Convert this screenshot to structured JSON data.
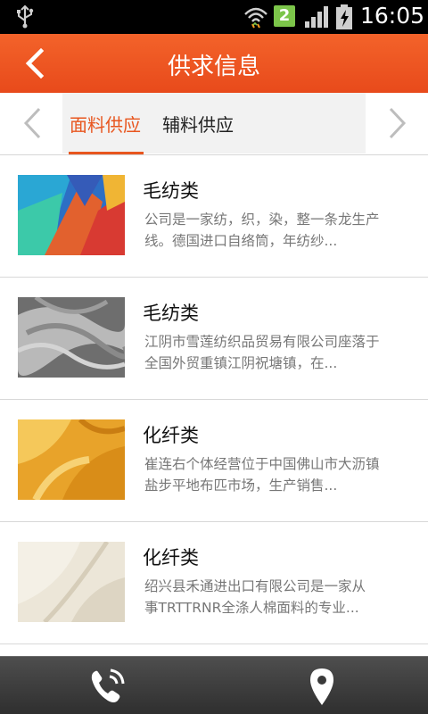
{
  "status_bar": {
    "time": "16:05",
    "sim_slot": "2",
    "icons": [
      "usb-icon",
      "wifi-icon",
      "sim-icon",
      "signal-icon",
      "battery-charging-icon"
    ]
  },
  "header": {
    "title": "供求信息",
    "back_icon": "chevron-left-icon",
    "background": "#ec5420"
  },
  "tabs": {
    "items": [
      {
        "label": "面料供应",
        "active": true
      },
      {
        "label": "辅料供应",
        "active": false
      }
    ],
    "accent": "#e8561f"
  },
  "items": [
    {
      "name": "毛纺类",
      "desc_line1": "公司是一家纺，织，染，整一条龙生产",
      "desc_line2": "线。德国进口自络筒，年纺纱...",
      "image": "colorful-fabric"
    },
    {
      "name": "毛纺类",
      "desc_line1": "江阴市雪莲纺织品贸易有限公司座落于",
      "desc_line2": "全国外贸重镇江阴祝塘镇，在...",
      "image": "grey-knit-fabric"
    },
    {
      "name": "化纤类",
      "desc_line1": "崔连右个体经营位于中国佛山市大沥镇",
      "desc_line2": "盐步平地布匹市场，生产销售...",
      "image": "yellow-chiffon-fabric"
    },
    {
      "name": "化纤类",
      "desc_line1": "绍兴县禾通进出口有限公司是一家从",
      "desc_line2": "事TRTTRNR全涤人棉面料的专业...",
      "image": "cream-canvas-fabric"
    }
  ],
  "bottom_bar": {
    "icons": [
      "phone-icon",
      "location-pin-icon"
    ]
  }
}
